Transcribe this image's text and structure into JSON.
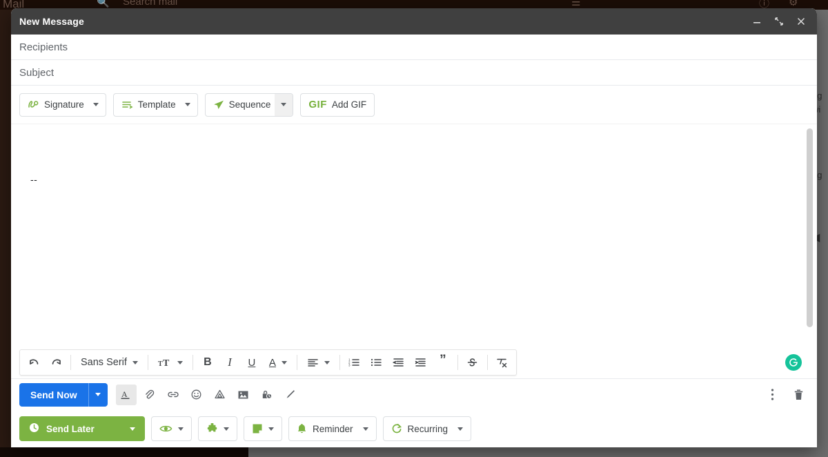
{
  "backdrop": {
    "app_name": "Mail",
    "search_placeholder": "Search mail",
    "icons": [
      "search-icon",
      "filter-icon",
      "help-icon",
      "settings-icon"
    ],
    "right_panel_fragments": [
      "ag",
      "wi",
      "ag"
    ]
  },
  "window": {
    "title": "New Message",
    "controls": {
      "minimize": "minimize-icon",
      "expand": "expand-icon",
      "close": "close-icon"
    }
  },
  "fields": {
    "recipients_placeholder": "Recipients",
    "subject_placeholder": "Subject"
  },
  "plugin_toolbar": [
    {
      "label": "Signature",
      "icon": "signature-icon",
      "has_caret": true,
      "split": false
    },
    {
      "label": "Template",
      "icon": "template-icon",
      "has_caret": true,
      "split": false
    },
    {
      "label": "Sequence",
      "icon": "sequence-send-icon",
      "has_caret": true,
      "split": true
    },
    {
      "label": "Add GIF",
      "icon": "gif-logo",
      "logo_text": "GIF",
      "has_caret": false,
      "split": false
    }
  ],
  "body": {
    "signature_separator": "--",
    "scrollbar": "vertical-scrollbar"
  },
  "format_toolbar": {
    "undo": "undo-icon",
    "redo": "redo-icon",
    "font_family": "Sans Serif",
    "font_size": "font-size-icon",
    "bold": "B",
    "italic": "I",
    "underline": "U",
    "text_color": "A",
    "align": "align-icon",
    "numbered_list": "numbered-list-icon",
    "bulleted_list": "bulleted-list-icon",
    "indent_less": "indent-less-icon",
    "indent_more": "indent-more-icon",
    "quote": "”",
    "strikethrough": "strikethrough-icon",
    "remove_format": "remove-formatting-icon",
    "grammarly": "grammarly-icon"
  },
  "send_bar": {
    "send_label": "Send Now",
    "send_caret": "send-options-caret",
    "icons": [
      "formatting-options-icon",
      "attach-file-icon",
      "insert-link-icon",
      "insert-emoji-icon",
      "insert-drive-icon",
      "insert-photo-icon",
      "confidential-mode-icon",
      "insert-signature-icon"
    ],
    "more_options": "more-options-icon",
    "discard": "discard-draft-icon"
  },
  "green_bar": [
    {
      "label": "Send Later",
      "icon": "clock-icon",
      "primary": true,
      "has_caret": true
    },
    {
      "label": "",
      "icon": "eye-tracking-icon",
      "primary": false,
      "has_caret": true
    },
    {
      "label": "",
      "icon": "puzzle-icon",
      "primary": false,
      "has_caret": true
    },
    {
      "label": "",
      "icon": "note-icon",
      "primary": false,
      "has_caret": true
    },
    {
      "label": "Reminder",
      "icon": "bell-icon",
      "primary": false,
      "has_caret": true
    },
    {
      "label": "Recurring",
      "icon": "recurring-icon",
      "primary": false,
      "has_caret": true
    }
  ],
  "colors": {
    "header_bg": "#404040",
    "send_blue": "#1a73e8",
    "plugin_green": "#7cb342",
    "grammarly_green": "#15c39a"
  }
}
